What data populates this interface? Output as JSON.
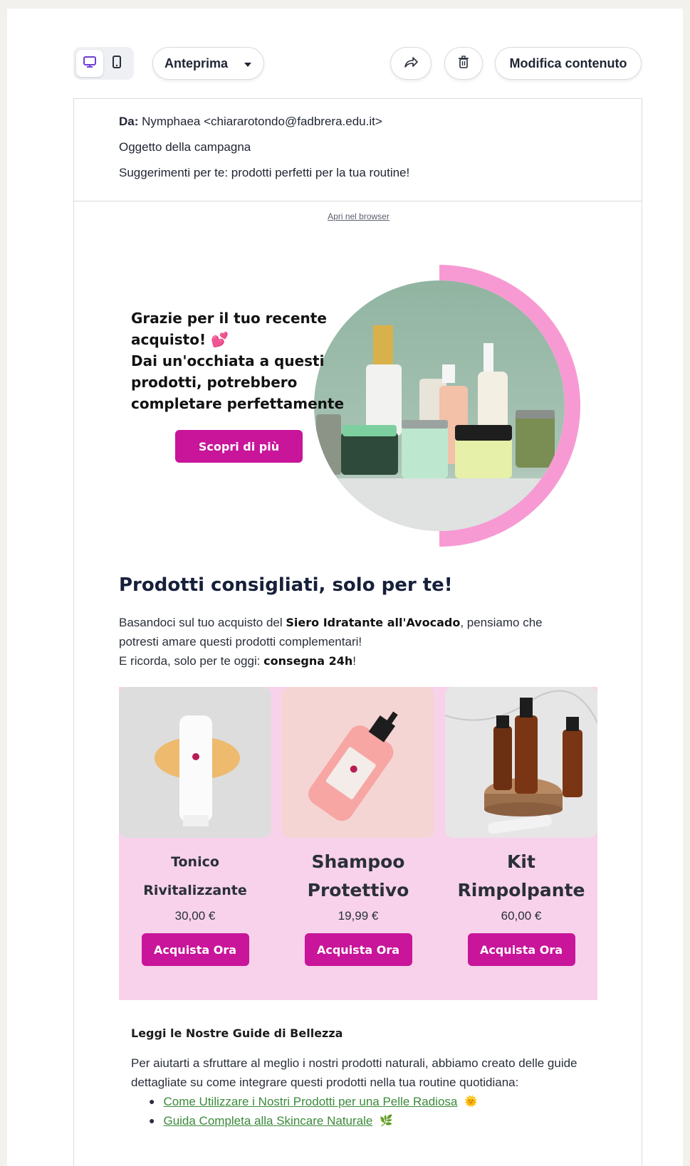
{
  "toolbar": {
    "preview_label": "Anteprima",
    "edit_label": "Modifica contenuto"
  },
  "header": {
    "from_label": "Da:",
    "from_value": "Nymphaea <chiararotondo@fadbrera.edu.it>",
    "subject_label": "Oggetto della campagna",
    "subject_value": "Suggerimenti per te: prodotti perfetti per la tua routine!"
  },
  "email": {
    "open_in_browser": "Apri nel browser",
    "hero": {
      "line1": "Grazie per il tuo recente acquisto!",
      "heart": "💕",
      "line2": "Dai un'occhiata a questi prodotti, potrebbero completare perfettamente",
      "cta": "Scopri di più"
    },
    "recommended": {
      "title": "Prodotti consigliati, solo per te!",
      "body_prefix": "Basandoci sul tuo acquisto del ",
      "body_product": "Siero Idratante all'Avocado",
      "body_suffix": ", pensiamo che potresti amare questi prodotti complementari!",
      "body_line2_prefix": "E ricorda, solo per te oggi: ",
      "body_line2_bold": "consegna 24h",
      "body_line2_suffix": "!"
    },
    "products": [
      {
        "name": "Tonico Rivitalizzante",
        "price": "30,00 €",
        "cta": "Acquista Ora"
      },
      {
        "name": "Shampoo Protettivo",
        "price": "19,99 €",
        "cta": "Acquista Ora"
      },
      {
        "name": "Kit Rimpolpante",
        "price": "60,00 €",
        "cta": "Acquista Ora"
      }
    ],
    "guides": {
      "title": "Leggi le Nostre Guide di Bellezza",
      "body": "Per aiutarti a sfruttare al meglio i nostri prodotti naturali, abbiamo creato delle guide dettagliate su come integrare questi prodotti nella tua routine quotidiana:",
      "links": [
        {
          "label": "Come Utilizzare i Nostri Prodotti per una Pelle Radiosa",
          "emoji": "🌞"
        },
        {
          "label": "Guida Completa alla Skincare Naturale",
          "emoji": "🌿"
        }
      ]
    }
  },
  "colors": {
    "accent": "#c8159a",
    "product_panel": "#f7d2ea",
    "ring_pink": "#f79ad3",
    "link_green": "#3b8a3b"
  }
}
